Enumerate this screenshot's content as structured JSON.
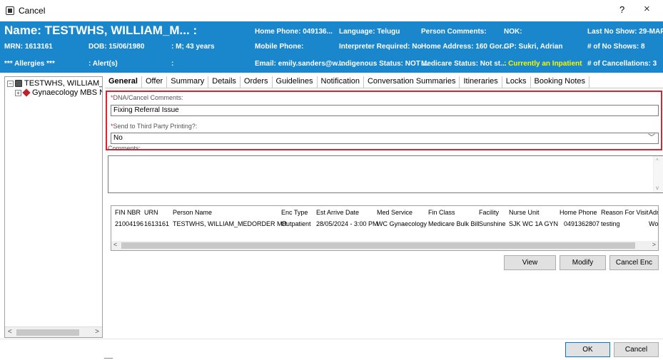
{
  "window": {
    "title": "Cancel",
    "help_label": "?",
    "close_label": "×"
  },
  "banner": {
    "name": "Name: TESTWHS, WILLIAM_M... :",
    "mrn": "MRN: 1613161",
    "dob": "DOB: 15/06/1980",
    "sex_age": ": M; 43 years",
    "allergies": "*** Allergies ***",
    "alerts": ": Alert(s)",
    "alerts_value": ":",
    "home_phone": "Home Phone:   049136...",
    "mobile_phone": "Mobile Phone:",
    "email": "Email: emily.sanders@w...",
    "language": "Language: Telugu",
    "interpreter": "Interpreter Required: No",
    "indigenous": "Indigenous Status: NOT ...",
    "person_comments": "Person Comments:",
    "home_address": "Home Address: 160 Gor...",
    "medicare": "Medicare Status: Not st...",
    "nok": "NOK:",
    "gp": "GP: Sukri, Adrian",
    "inpatient": ": Currently an Inpatient",
    "last_no_show": "Last No Show: 29-MAR-...",
    "no_shows": "# of No Shows: 8",
    "cancellations": "# of Cancellations: 3",
    "colors": {
      "background": "#1a87cc",
      "highlight": "#f8f800"
    }
  },
  "tree": {
    "root_label": "TESTWHS, WILLIAM_ME",
    "child_label": "Gynaecology MBS N",
    "scroll_left": "<",
    "scroll_right": ">"
  },
  "tabs": [
    "General",
    "Offer",
    "Summary",
    "Details",
    "Orders",
    "Guidelines",
    "Notification",
    "Conversation Summaries",
    "Itineraries",
    "Locks",
    "Booking Notes"
  ],
  "form": {
    "required_mark": "*",
    "dna_label": "DNA/Cancel Comments:",
    "dna_value": "Fixing Referral Issue",
    "third_party_label": "Send to Third Party Printing?:",
    "third_party_value": "No",
    "comments_label": "Comments:",
    "comments_value": ""
  },
  "table": {
    "headers": [
      "FIN NBR",
      "URN",
      "Person Name",
      "Enc Type",
      "Est Arrive Date",
      "Med Service",
      "Fin Class",
      "Facility",
      "Nurse Unit",
      "Home Phone",
      "Reason For Visit",
      "Adm"
    ],
    "rows": [
      [
        "21004196",
        "1613161",
        "TESTWHS, WILLIAM_MEDORDER  MR",
        "Outpatient",
        "28/05/2024 - 3:00 PM",
        "WC Gynaecology",
        "Medicare Bulk Bill",
        "Sunshine",
        "SJK WC 1A GYN",
        "0491362807",
        "testing",
        "Wo"
      ]
    ]
  },
  "actions": {
    "view": "View",
    "modify": "Modify",
    "cancel_enc": "Cancel Enc"
  },
  "footer": {
    "ok": "OK",
    "cancel": "Cancel"
  },
  "accent": {
    "required_box": "#e0202a"
  }
}
